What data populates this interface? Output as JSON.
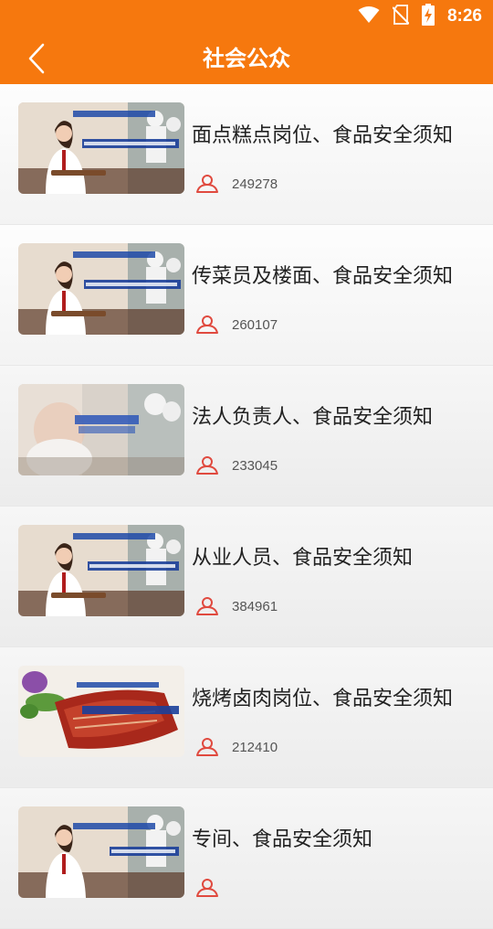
{
  "status": {
    "time": "8:26"
  },
  "header": {
    "title": "社会公众"
  },
  "colors": {
    "accent": "#f6780e",
    "icon": "#e04a3f"
  },
  "items": [
    {
      "title": "面点糕点岗位、食品安全须知",
      "views": "249278",
      "thumb": "chef-woman-tray"
    },
    {
      "title": "传菜员及楼面、食品安全须知",
      "views": "260107",
      "thumb": "chef-woman-tray"
    },
    {
      "title": "法人负责人、食品安全须知",
      "views": "233045",
      "thumb": "blurred-chef"
    },
    {
      "title": "从业人员、食品安全须知",
      "views": "384961",
      "thumb": "chef-woman-tray"
    },
    {
      "title": "烧烤卤肉岗位、食品安全须知",
      "views": "212410",
      "thumb": "roast-meat"
    },
    {
      "title": "专间、食品安全须知",
      "views": "",
      "thumb": "chef-woman-tray"
    }
  ]
}
